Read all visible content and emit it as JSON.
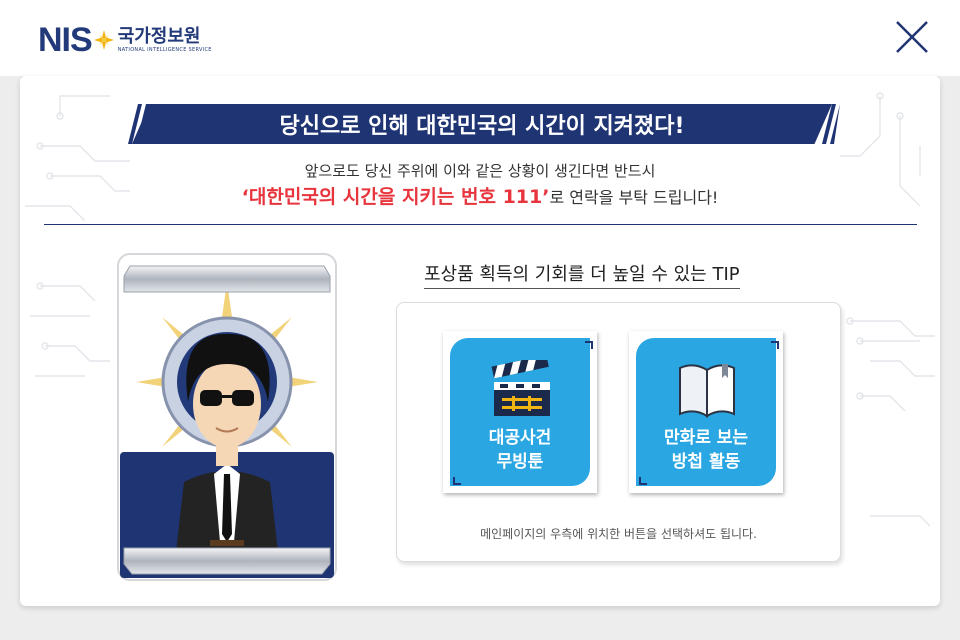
{
  "header": {
    "logo_mark": "NIS",
    "logo_name_kr": "국가정보원",
    "logo_name_en": "NATIONAL INTELLIGENCE SERVICE",
    "close_icon": "close-x-icon"
  },
  "result": {
    "banner_title": "당신으로 인해 대한민국의 시간이 지켜졌다!",
    "message_line1": "앞으로도 당신 주위에 이와 같은 상황이 생긴다면 반드시",
    "message_highlight": "‘대한민국의 시간을 지키는 번호 111’",
    "message_line2_rest": "로 연락을 부탁 드립니다!"
  },
  "tips": {
    "title": "포상품 획득의 기회를 더 높일 수 있는 TIP",
    "buttons": [
      {
        "icon": "clapperboard-icon",
        "line1": "대공사건",
        "line2": "무빙툰"
      },
      {
        "icon": "open-book-icon",
        "line1": "만화로 보는",
        "line2": "방첩 활동"
      }
    ],
    "note": "메인페이지의 우측에 위치한 버튼을 선택하셔도 됩니다."
  },
  "colors": {
    "navy": "#1f3472",
    "highlight_red": "#e8343c",
    "tile_blue": "#2aa7e2"
  }
}
